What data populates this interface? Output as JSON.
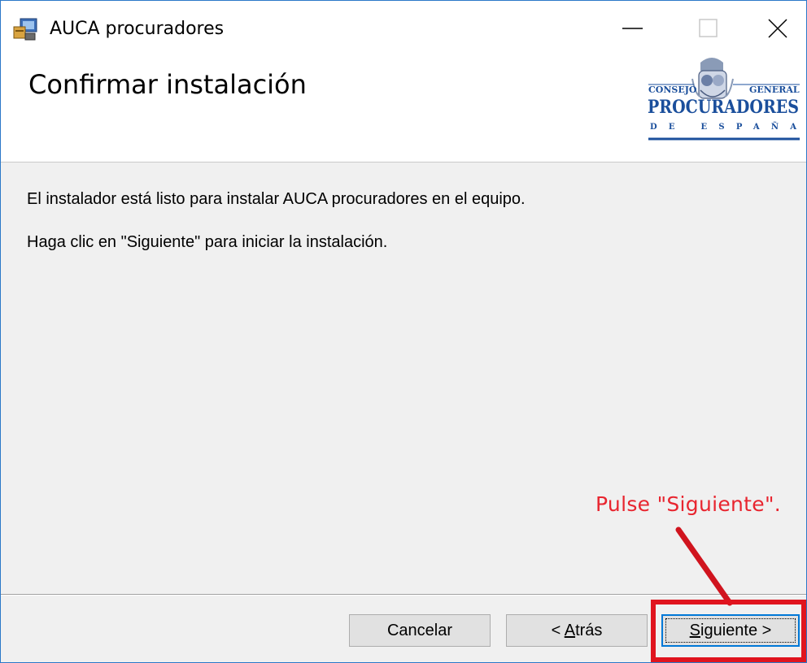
{
  "window": {
    "title": "AUCA procuradores",
    "controls": {
      "minimize_icon": "minimize-icon",
      "maximize_icon": "maximize-icon",
      "close_icon": "close-icon"
    }
  },
  "header": {
    "title": "Confirmar instalación",
    "logo": {
      "line1_left": "CONSEJO",
      "line1_right": "GENERAL",
      "line2": "PROCURADORES",
      "line3": "DE ESPAÑA"
    }
  },
  "content": {
    "message_1": "El instalador está listo para instalar AUCA procuradores en el equipo.",
    "message_2": "Haga clic en \"Siguiente\" para iniciar la instalación."
  },
  "annotation": {
    "text": "Pulse \"Siguiente\".",
    "color": "#e8252f"
  },
  "buttons": {
    "cancel": "Cancelar",
    "back_prefix": "< ",
    "back_accel": "A",
    "back_rest": "trás",
    "next_accel": "S",
    "next_rest": "iguiente >"
  },
  "colors": {
    "window_border": "#2b78c8",
    "focus_border": "#0078d7",
    "highlight": "#e0141e",
    "logo_blue": "#1b4f9c"
  }
}
